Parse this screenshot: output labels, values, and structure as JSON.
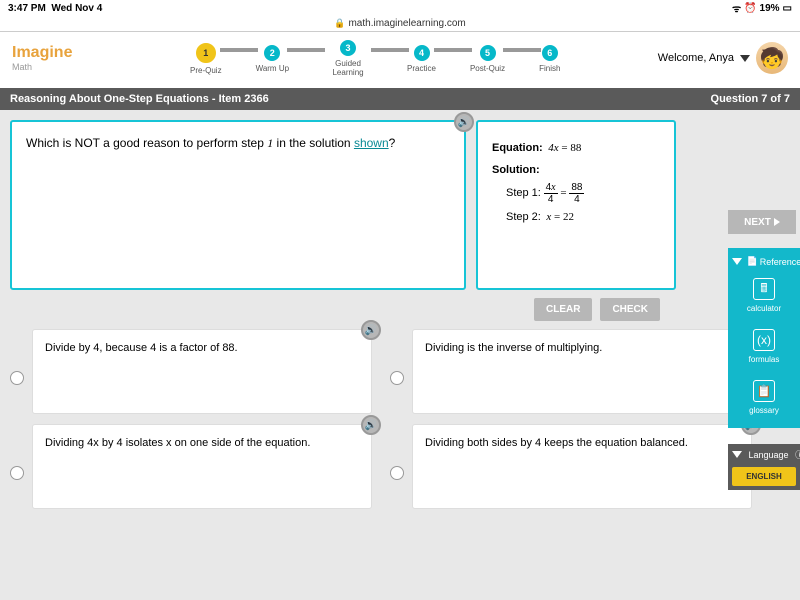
{
  "status": {
    "time": "3:47 PM",
    "date": "Wed Nov 4",
    "battery": "19%"
  },
  "url": "math.imaginelearning.com",
  "logo": {
    "main": "Imagine",
    "sub": "Math"
  },
  "steps": [
    {
      "num": "1",
      "label": "Pre-Quiz"
    },
    {
      "num": "2",
      "label": "Warm Up"
    },
    {
      "num": "3",
      "label": "Guided Learning"
    },
    {
      "num": "4",
      "label": "Practice"
    },
    {
      "num": "5",
      "label": "Post-Quiz"
    },
    {
      "num": "6",
      "label": "Finish"
    }
  ],
  "welcome": "Welcome, Anya",
  "bar": {
    "title": "Reasoning About One-Step Equations - Item 2366",
    "progress": "Question 7 of 7"
  },
  "question": {
    "pre": "Which is NOT a good reason to perform step ",
    "step": "1",
    "post": " in the solution ",
    "link": "shown",
    "after": "?"
  },
  "equation": {
    "label": "Equation:",
    "expr": "4x = 88",
    "sol_label": "Solution:",
    "step1_label": "Step 1:",
    "step1_lt": "4x",
    "step1_lb": "4",
    "step1_rt": "88",
    "step1_rb": "4",
    "step2_label": "Step 2:",
    "step2": "x = 22"
  },
  "buttons": {
    "clear": "CLEAR",
    "check": "CHECK",
    "next": "NEXT"
  },
  "answers": [
    "Divide by 4, because 4 is a factor of 88.",
    "Dividing is the inverse of multiplying.",
    "Dividing 4x by 4 isolates x on one side of the equation.",
    "Dividing both sides by 4 keeps the equation balanced."
  ],
  "ref": {
    "title": "Reference",
    "calc": "calculator",
    "form": "formulas",
    "glos": "glossary"
  },
  "lang": {
    "title": "Language",
    "btn": "ENGLISH"
  }
}
